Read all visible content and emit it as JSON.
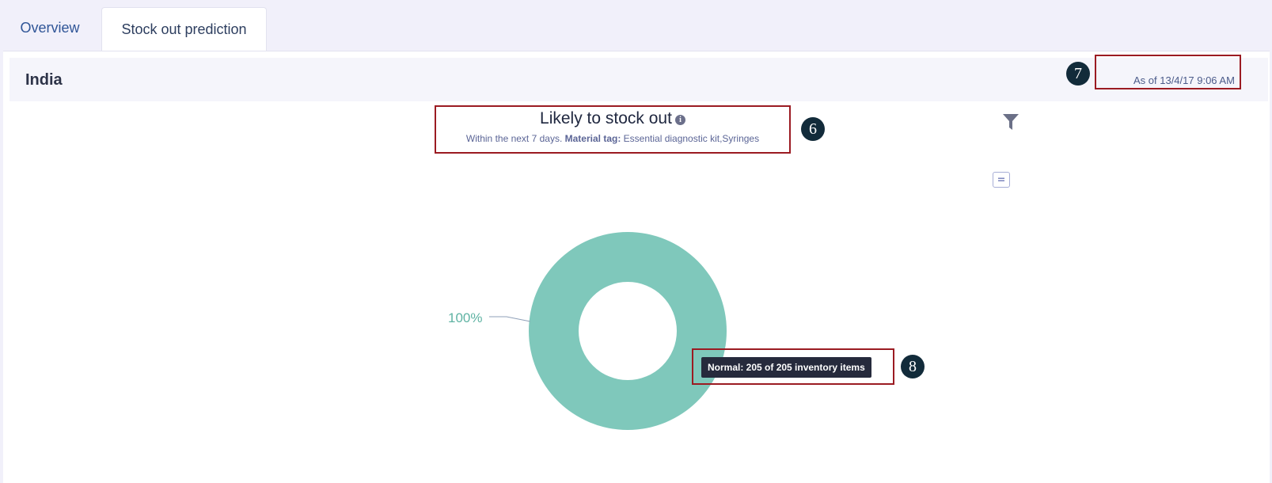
{
  "tabs": [
    {
      "label": "Overview",
      "active": false
    },
    {
      "label": "Stock out prediction",
      "active": true
    }
  ],
  "header": {
    "region": "India",
    "as_of": "As of 13/4/17 9:06 AM"
  },
  "chart_header": {
    "title": "Likely to stock out",
    "info_icon_glyph": "i",
    "subtitle_prefix": "Within the next 7 days.",
    "material_tag_label": "Material tag:",
    "material_tag_value": "Essential diagnostic kit,Syringes"
  },
  "tooltip": {
    "text": "Normal: 205 of 205 inventory items"
  },
  "annotations": {
    "chart_title_marker": "6",
    "as_of_marker": "7",
    "tooltip_marker": "8"
  },
  "icons": {
    "filter": "filter-icon",
    "menu": "menu-icon",
    "info": "info-icon"
  },
  "colors": {
    "normal_slice": "#7fc8bb",
    "callout_border": "#9b1b22",
    "link_blue": "#2f5597"
  },
  "chart_data": {
    "type": "pie",
    "donut": true,
    "title": "Likely to stock out",
    "subtitle": "Within the next 7 days. Material tag: Essential diagnostic kit,Syringes",
    "slices": [
      {
        "name": "Normal",
        "value": 205,
        "total": 205,
        "percent": 100,
        "label": "100%"
      }
    ]
  }
}
